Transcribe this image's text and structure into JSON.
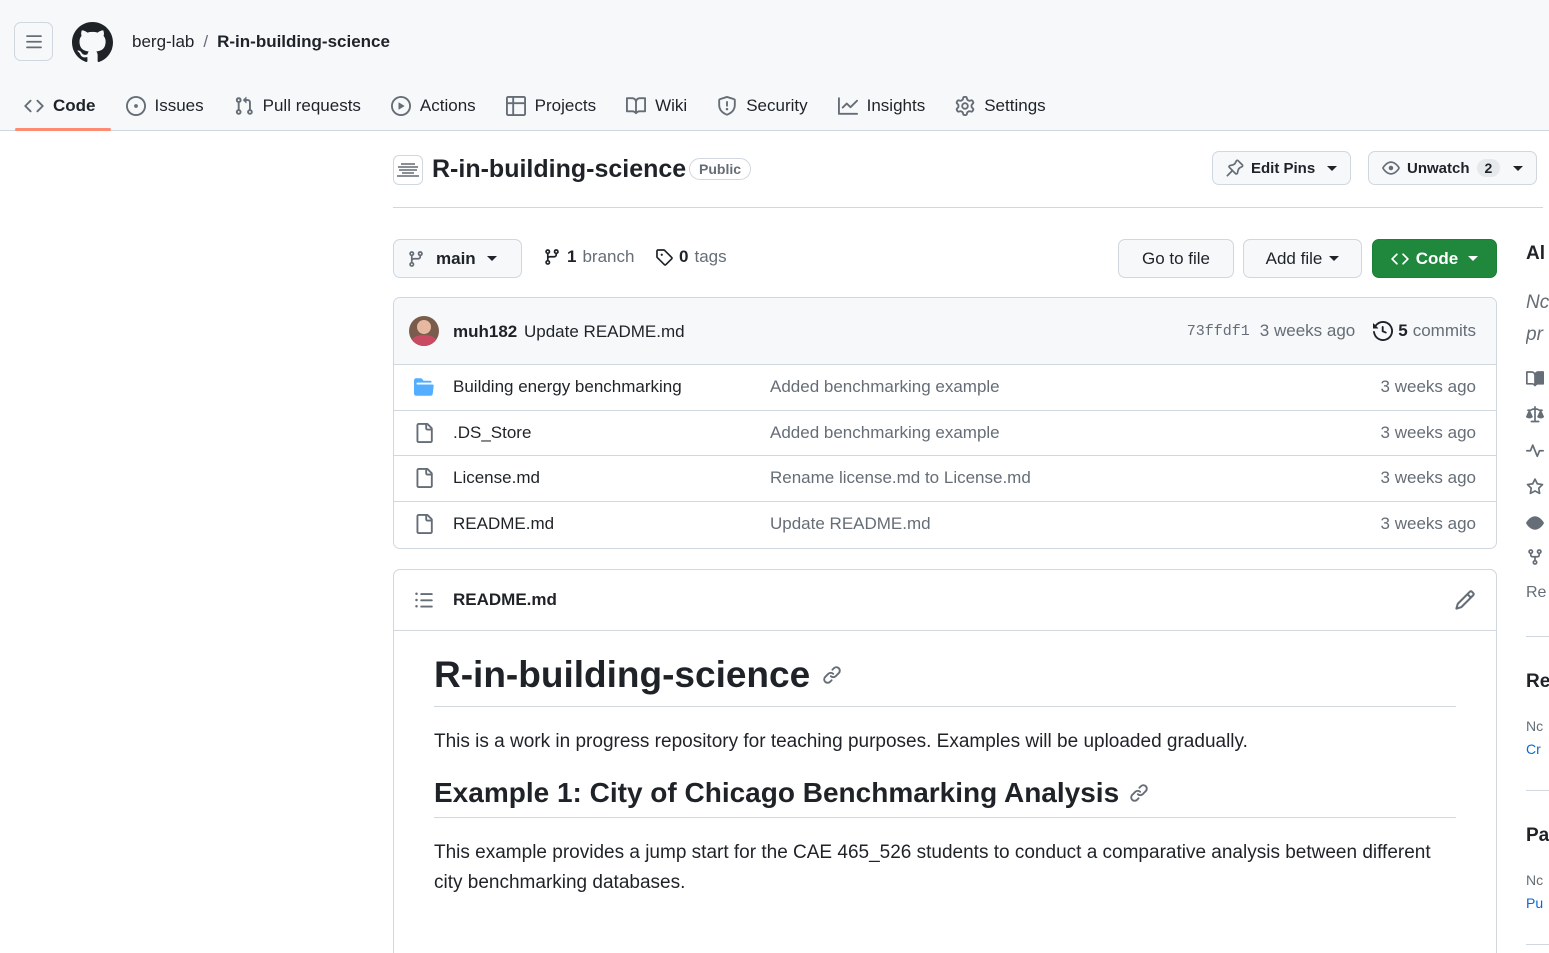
{
  "header": {
    "owner": "berg-lab",
    "separator": "/",
    "repo": "R-in-building-science",
    "icons": {
      "menu": "hamburger-icon",
      "logo": "github-logo-icon"
    }
  },
  "tabs": [
    {
      "label": "Code",
      "icon": "code-icon",
      "active": true
    },
    {
      "label": "Issues",
      "icon": "issue-opened-icon"
    },
    {
      "label": "Pull requests",
      "icon": "git-pull-request-icon"
    },
    {
      "label": "Actions",
      "icon": "play-icon"
    },
    {
      "label": "Projects",
      "icon": "table-icon"
    },
    {
      "label": "Wiki",
      "icon": "book-icon"
    },
    {
      "label": "Security",
      "icon": "shield-icon"
    },
    {
      "label": "Insights",
      "icon": "graph-icon"
    },
    {
      "label": "Settings",
      "icon": "gear-icon"
    }
  ],
  "repo_head": {
    "title": "R-in-building-science",
    "visibility": "Public",
    "edit_pins": "Edit Pins",
    "unwatch": "Unwatch",
    "watch_count": "2"
  },
  "toolbar": {
    "branch": "main",
    "branch_count": "1",
    "branch_label": "branch",
    "tag_count": "0",
    "tag_label": "tags",
    "go_to_file": "Go to file",
    "add_file": "Add file",
    "code": "Code"
  },
  "latest_commit": {
    "author": "muh182",
    "message": "Update README.md",
    "sha": "73ffdf1",
    "age": "3 weeks ago",
    "commit_count": "5",
    "commit_label": "commits"
  },
  "files": [
    {
      "name": "Building energy benchmarking",
      "type": "folder",
      "commit": "Added benchmarking example",
      "age": "3 weeks ago"
    },
    {
      "name": ".DS_Store",
      "type": "file",
      "commit": "Added benchmarking example",
      "age": "3 weeks ago"
    },
    {
      "name": "License.md",
      "type": "file",
      "commit": "Rename license.md to License.md",
      "age": "3 weeks ago"
    },
    {
      "name": "README.md",
      "type": "file",
      "commit": "Update README.md",
      "age": "3 weeks ago"
    }
  ],
  "readme": {
    "filename": "README.md",
    "h1": "R-in-building-science",
    "intro": "This is a work in progress repository for teaching purposes. Examples will be uploaded gradually.",
    "h2": "Example 1: City of Chicago Benchmarking Analysis",
    "example_text": "This example provides a jump start for the CAE 465_526 students to conduct a comparative analysis between different city benchmarking databases."
  },
  "sidebar_clipped": {
    "about_heading": "Al",
    "desc_line1": "Nc",
    "desc_line2": "pr",
    "readme_link": "Re",
    "releases_heading": "Re",
    "releases_none": "Nc",
    "releases_create": "Cr",
    "packages_heading": "Pa",
    "packages_none": "Nc",
    "packages_publish": "Pu"
  },
  "colors": {
    "accent_green": "#1f883d",
    "tab_underline": "#fd8c73",
    "folder_blue": "#54aeff",
    "link_blue": "#0969da",
    "muted": "#656d76",
    "border": "#d0d7de"
  }
}
